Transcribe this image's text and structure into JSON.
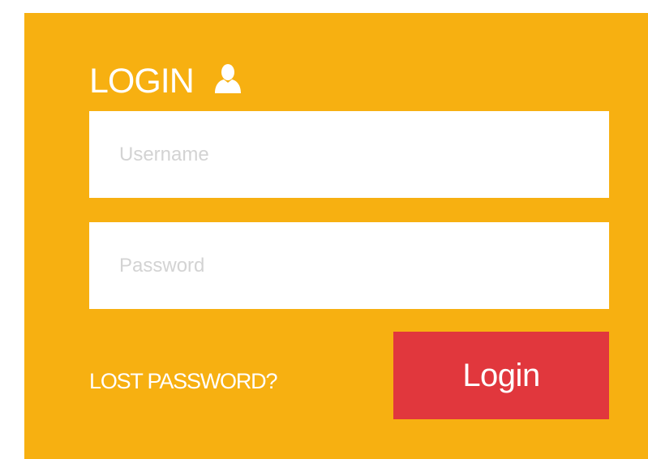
{
  "login_form": {
    "title": "LOGIN",
    "title_icon": "user-icon",
    "username": {
      "value": "",
      "placeholder": "Username"
    },
    "password": {
      "value": "",
      "placeholder": "Password"
    },
    "lost_password_label": "LOST PASSWORD?",
    "submit_label": "Login"
  },
  "colors": {
    "panel_background": "#F7B011",
    "button_background": "#E1373D",
    "text_on_panel": "#FFFFFF",
    "input_background": "#FFFFFF",
    "placeholder_text": "#D3D3D3"
  }
}
